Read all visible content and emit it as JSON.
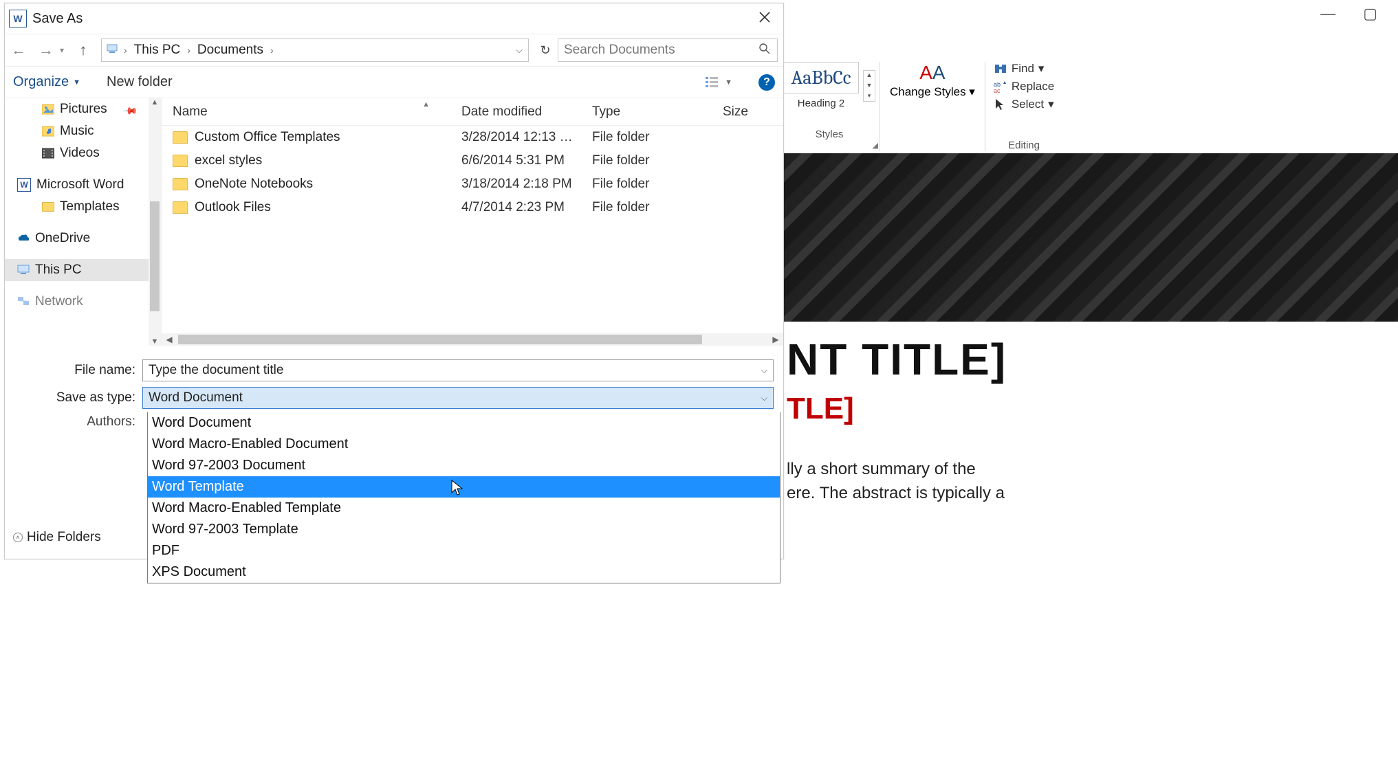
{
  "dialog": {
    "title": "Save As",
    "breadcrumb": {
      "root": "This PC",
      "folder": "Documents"
    },
    "search_placeholder": "Search Documents",
    "toolbar": {
      "organize": "Organize",
      "new_folder": "New folder"
    },
    "nav": {
      "pictures": "Pictures",
      "music": "Music",
      "videos": "Videos",
      "msword": "Microsoft Word",
      "templates": "Templates",
      "onedrive": "OneDrive",
      "thispc": "This PC",
      "network": "Network"
    },
    "columns": {
      "name": "Name",
      "date": "Date modified",
      "type": "Type",
      "size": "Size"
    },
    "rows": [
      {
        "name": "Custom Office Templates",
        "date": "3/28/2014 12:13 …",
        "type": "File folder"
      },
      {
        "name": "excel styles",
        "date": "6/6/2014 5:31 PM",
        "type": "File folder"
      },
      {
        "name": "OneNote Notebooks",
        "date": "3/18/2014 2:18 PM",
        "type": "File folder"
      },
      {
        "name": "Outlook Files",
        "date": "4/7/2014 2:23 PM",
        "type": "File folder"
      }
    ],
    "labels": {
      "filename": "File name:",
      "saveastype": "Save as type:",
      "authors": "Authors:"
    },
    "filename_value": "Type the document title",
    "saveastype_value": "Word Document",
    "type_options": [
      "Word Document",
      "Word Macro-Enabled Document",
      "Word 97-2003 Document",
      "Word Template",
      "Word Macro-Enabled Template",
      "Word 97-2003 Template",
      "PDF",
      "XPS Document"
    ],
    "type_highlight_index": 3,
    "hide_folders": "Hide Folders"
  },
  "ribbon": {
    "style_sample": "AaBbCc",
    "style_name": "Heading 2",
    "change_styles": "Change Styles",
    "styles_caption": "Styles",
    "find": "Find",
    "replace": "Replace",
    "select": "Select",
    "editing_caption": "Editing"
  },
  "doc": {
    "title_fragment": "NT TITLE]",
    "subtitle_fragment": "TLE]",
    "body_line1": "lly a short summary of the",
    "body_line2": "ere. The abstract is typically a"
  }
}
